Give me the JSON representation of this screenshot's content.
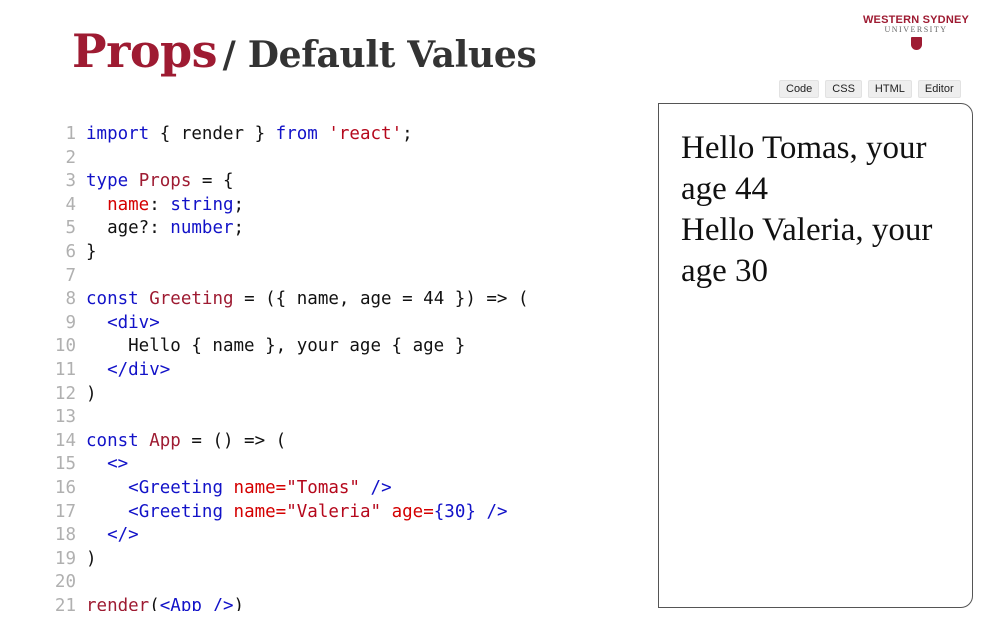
{
  "slide": {
    "title_main": "Props",
    "title_sub": "/ Default Values"
  },
  "logo": {
    "line1": "WESTERN SYDNEY",
    "line2": "UNIVERSITY"
  },
  "tabs": [
    "Code",
    "CSS",
    "HTML",
    "Editor"
  ],
  "code": {
    "lines": [
      [
        {
          "t": "import",
          "c": "kw"
        },
        {
          "t": " { render } ",
          "c": "pl"
        },
        {
          "t": "from",
          "c": "kw"
        },
        {
          "t": " ",
          "c": "pl"
        },
        {
          "t": "'react'",
          "c": "st"
        },
        {
          "t": ";",
          "c": "pl"
        }
      ],
      [],
      [
        {
          "t": "type",
          "c": "kw"
        },
        {
          "t": " ",
          "c": "pl"
        },
        {
          "t": "Props",
          "c": "nm"
        },
        {
          "t": " = {",
          "c": "pl"
        }
      ],
      [
        {
          "t": "  ",
          "c": "pl"
        },
        {
          "t": "name",
          "c": "pr"
        },
        {
          "t": ": ",
          "c": "pl"
        },
        {
          "t": "string",
          "c": "ty"
        },
        {
          "t": ";",
          "c": "pl"
        }
      ],
      [
        {
          "t": "  age?: ",
          "c": "pl"
        },
        {
          "t": "number",
          "c": "ty"
        },
        {
          "t": ";",
          "c": "pl"
        }
      ],
      [
        {
          "t": "}",
          "c": "pl"
        }
      ],
      [],
      [
        {
          "t": "const",
          "c": "kw"
        },
        {
          "t": " ",
          "c": "pl"
        },
        {
          "t": "Greeting",
          "c": "nm"
        },
        {
          "t": " = ({ name, age = 44 }) => (",
          "c": "pl"
        }
      ],
      [
        {
          "t": "  ",
          "c": "pl"
        },
        {
          "t": "<div>",
          "c": "tg"
        }
      ],
      [
        {
          "t": "    Hello { name }, your age { age }",
          "c": "pl"
        }
      ],
      [
        {
          "t": "  ",
          "c": "pl"
        },
        {
          "t": "</div>",
          "c": "tg"
        }
      ],
      [
        {
          "t": ")",
          "c": "pl"
        }
      ],
      [],
      [
        {
          "t": "const",
          "c": "kw"
        },
        {
          "t": " ",
          "c": "pl"
        },
        {
          "t": "App",
          "c": "nm"
        },
        {
          "t": " = () => (",
          "c": "pl"
        }
      ],
      [
        {
          "t": "  ",
          "c": "pl"
        },
        {
          "t": "<>",
          "c": "tg"
        }
      ],
      [
        {
          "t": "    ",
          "c": "pl"
        },
        {
          "t": "<Greeting",
          "c": "tg"
        },
        {
          "t": " ",
          "c": "pl"
        },
        {
          "t": "name=",
          "c": "pr"
        },
        {
          "t": "\"Tomas\"",
          "c": "st"
        },
        {
          "t": " ",
          "c": "pl"
        },
        {
          "t": "/>",
          "c": "tg"
        }
      ],
      [
        {
          "t": "    ",
          "c": "pl"
        },
        {
          "t": "<Greeting",
          "c": "tg"
        },
        {
          "t": " ",
          "c": "pl"
        },
        {
          "t": "name=",
          "c": "pr"
        },
        {
          "t": "\"Valeria\"",
          "c": "st"
        },
        {
          "t": " ",
          "c": "pl"
        },
        {
          "t": "age=",
          "c": "pr"
        },
        {
          "t": "{30}",
          "c": "nu"
        },
        {
          "t": " ",
          "c": "pl"
        },
        {
          "t": "/>",
          "c": "tg"
        }
      ],
      [
        {
          "t": "  ",
          "c": "pl"
        },
        {
          "t": "</>",
          "c": "tg"
        }
      ],
      [
        {
          "t": ")",
          "c": "pl"
        }
      ],
      [],
      [
        {
          "t": "render",
          "c": "nm"
        },
        {
          "t": "(",
          "c": "pl"
        },
        {
          "t": "<App />",
          "c": "tg"
        },
        {
          "t": ")",
          "c": "pl"
        }
      ]
    ]
  },
  "preview": {
    "lines": [
      "Hello Tomas, your age 44",
      "Hello Valeria, your age 30"
    ]
  }
}
